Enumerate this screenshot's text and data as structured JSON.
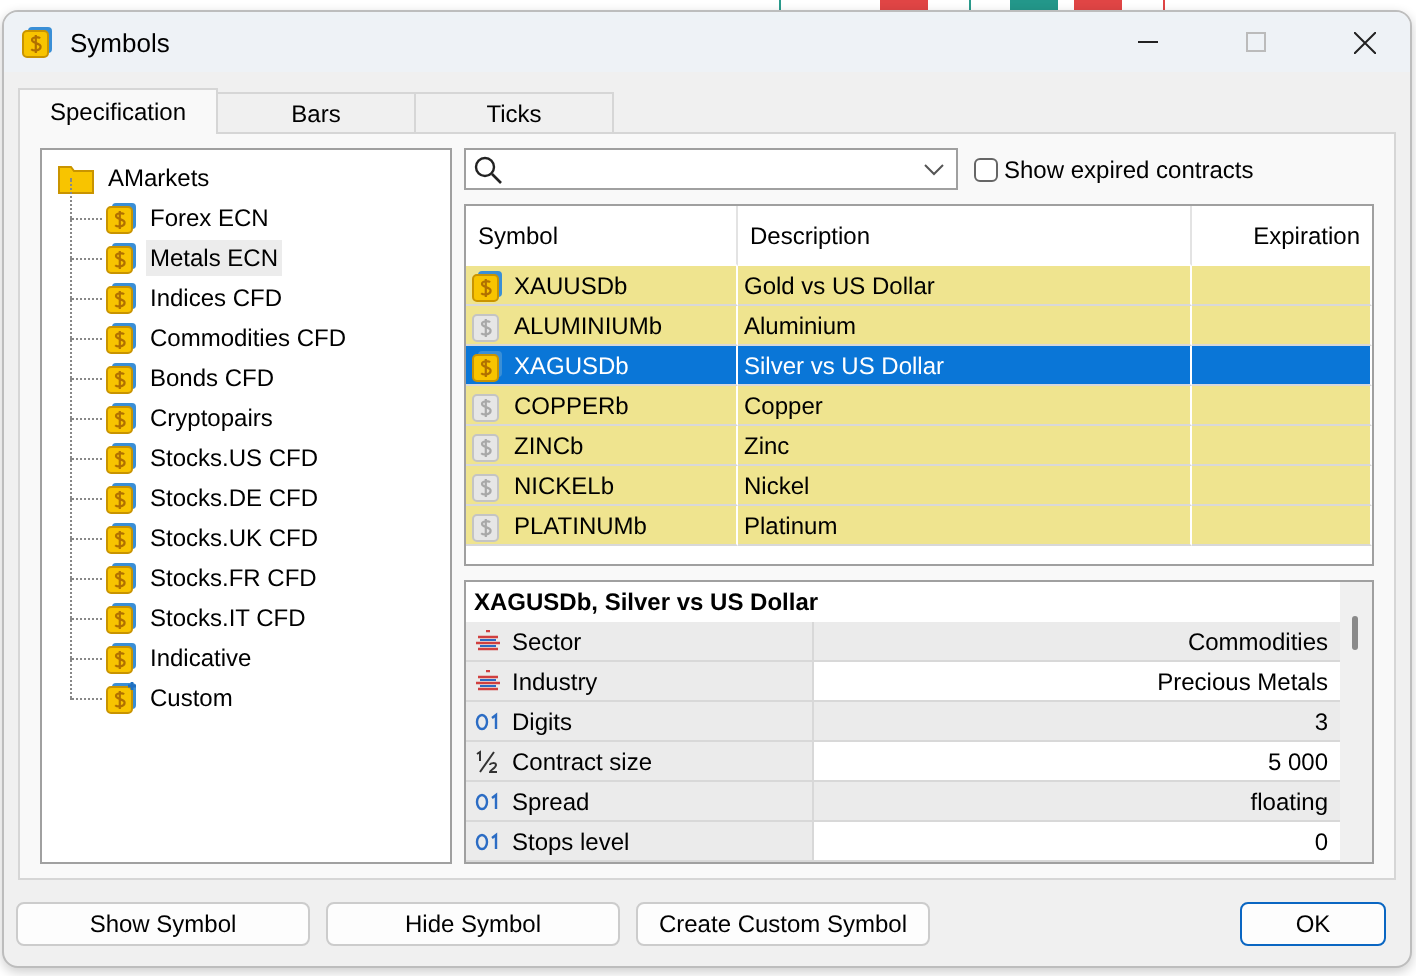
{
  "window": {
    "title": "Symbols",
    "buttons": [
      "Show Symbol",
      "Hide Symbol",
      "Create Custom Symbol"
    ],
    "default_button": "OK"
  },
  "tabs": [
    {
      "label": "Specification",
      "selected": true
    },
    {
      "label": "Bars",
      "selected": false
    },
    {
      "label": "Ticks",
      "selected": false
    }
  ],
  "tree": {
    "label": "AMarkets",
    "children": [
      {
        "label": "Forex ECN",
        "kind": "group",
        "selected": false
      },
      {
        "label": "Metals ECN",
        "kind": "group",
        "selected": true
      },
      {
        "label": "Indices CFD",
        "kind": "group",
        "selected": false
      },
      {
        "label": "Commodities CFD",
        "kind": "group",
        "selected": false
      },
      {
        "label": "Bonds CFD",
        "kind": "group",
        "selected": false
      },
      {
        "label": "Cryptopairs",
        "kind": "group",
        "selected": false
      },
      {
        "label": "Stocks.US CFD",
        "kind": "group",
        "selected": false
      },
      {
        "label": "Stocks.DE CFD",
        "kind": "group",
        "selected": false
      },
      {
        "label": "Stocks.UK CFD",
        "kind": "group",
        "selected": false
      },
      {
        "label": "Stocks.FR CFD",
        "kind": "group",
        "selected": false
      },
      {
        "label": "Stocks.IT CFD",
        "kind": "group",
        "selected": false
      },
      {
        "label": "Indicative",
        "kind": "group",
        "selected": false
      },
      {
        "label": "Custom",
        "kind": "custom",
        "selected": false
      }
    ]
  },
  "filter": {
    "show_expired": {
      "label": "Show expired contracts",
      "checked": false
    }
  },
  "table": {
    "columns": [
      "Symbol",
      "Description",
      "Expiration"
    ],
    "rows": [
      {
        "symbol": "XAUUSDb",
        "description": "Gold vs US Dollar",
        "visible": true,
        "selected": false
      },
      {
        "symbol": "ALUMINIUMb",
        "description": "Aluminium",
        "visible": false,
        "selected": false
      },
      {
        "symbol": "XAGUSDb",
        "description": "Silver vs US Dollar",
        "visible": true,
        "selected": true
      },
      {
        "symbol": "COPPERb",
        "description": "Copper",
        "visible": false,
        "selected": false
      },
      {
        "symbol": "ZINCb",
        "description": "Zinc",
        "visible": false,
        "selected": false
      },
      {
        "symbol": "NICKELb",
        "description": "Nickel",
        "visible": false,
        "selected": false
      },
      {
        "symbol": "PLATINUMb",
        "description": "Platinum",
        "visible": false,
        "selected": false
      }
    ]
  },
  "details": {
    "title": "XAGUSDb, Silver vs US Dollar",
    "properties": [
      {
        "kind": "text",
        "label": "Sector",
        "value": "Commodities"
      },
      {
        "kind": "text",
        "label": "Industry",
        "value": "Precious Metals"
      },
      {
        "kind": "integer",
        "label": "Digits",
        "value": "3"
      },
      {
        "kind": "fraction",
        "label": "Contract size",
        "value": "5 000"
      },
      {
        "kind": "integer",
        "label": "Spread",
        "value": "floating"
      },
      {
        "kind": "integer",
        "label": "Stops level",
        "value": "0"
      }
    ]
  }
}
